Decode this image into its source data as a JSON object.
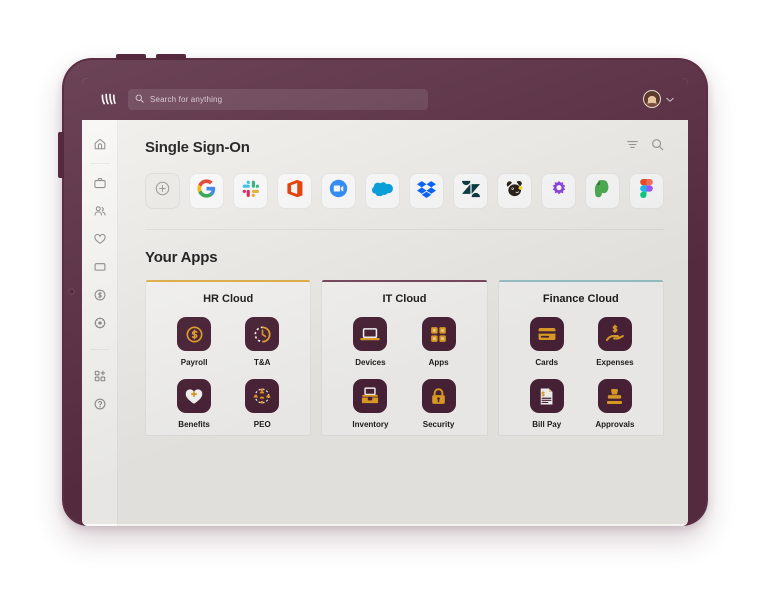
{
  "topbar": {
    "logo_icon": "rippling-logo-icon",
    "search": {
      "icon": "search-icon",
      "placeholder": "Search for anything",
      "value": ""
    },
    "avatar_name": "user-avatar",
    "chevron_icon": "chevron-down-icon"
  },
  "sidebar": {
    "items": [
      {
        "icon": "home-icon",
        "name": "home"
      },
      {
        "icon": "briefcase-icon",
        "name": "work"
      },
      {
        "icon": "people-icon",
        "name": "people"
      },
      {
        "icon": "heart-icon",
        "name": "benefits"
      },
      {
        "icon": "laptop-icon",
        "name": "devices"
      },
      {
        "icon": "dollar-icon",
        "name": "finance"
      },
      {
        "icon": "gear-icon",
        "name": "settings"
      },
      {
        "icon": "apps-grid-icon",
        "name": "apps"
      },
      {
        "icon": "help-icon",
        "name": "help"
      }
    ]
  },
  "sso": {
    "title": "Single Sign-On",
    "filter_icon": "filter-icon",
    "search_icon": "search-icon",
    "tiles": [
      {
        "name": "add-app",
        "label": "Add",
        "icon": "plus-circle-icon"
      },
      {
        "name": "google",
        "label": "Google",
        "icon": "google-icon"
      },
      {
        "name": "slack",
        "label": "Slack",
        "icon": "slack-icon"
      },
      {
        "name": "office",
        "label": "Office",
        "icon": "microsoft-office-icon"
      },
      {
        "name": "zoom",
        "label": "Zoom",
        "icon": "zoom-icon"
      },
      {
        "name": "salesforce",
        "label": "Salesforce",
        "icon": "salesforce-icon"
      },
      {
        "name": "dropbox",
        "label": "Dropbox",
        "icon": "dropbox-icon"
      },
      {
        "name": "zendesk",
        "label": "Zendesk",
        "icon": "zendesk-icon"
      },
      {
        "name": "mailchimp",
        "label": "Mailchimp",
        "icon": "mailchimp-icon"
      },
      {
        "name": "jamf",
        "label": "Jamf",
        "icon": "jamf-burst-icon"
      },
      {
        "name": "evernote",
        "label": "Evernote",
        "icon": "evernote-icon"
      },
      {
        "name": "figma",
        "label": "Figma",
        "icon": "figma-icon"
      }
    ]
  },
  "your_apps": {
    "title": "Your Apps",
    "cards": [
      {
        "title": "HR Cloud",
        "accent": "#e8b44a",
        "apps": [
          {
            "label": "Payroll",
            "icon": "dollar-circle-icon"
          },
          {
            "label": "T&A",
            "icon": "clock-icon"
          },
          {
            "label": "Benefits",
            "icon": "heart-plus-icon"
          },
          {
            "label": "PEO",
            "icon": "people-circle-icon"
          }
        ]
      },
      {
        "title": "IT Cloud",
        "accent": "#7a4a5e",
        "apps": [
          {
            "label": "Devices",
            "icon": "laptop-icon"
          },
          {
            "label": "Apps",
            "icon": "apps-grid-icon"
          },
          {
            "label": "Inventory",
            "icon": "laptop-box-icon"
          },
          {
            "label": "Security",
            "icon": "padlock-icon"
          }
        ]
      },
      {
        "title": "Finance Cloud",
        "accent": "#9ec9cc",
        "apps": [
          {
            "label": "Cards",
            "icon": "credit-card-icon"
          },
          {
            "label": "Expenses",
            "icon": "hand-dollar-icon"
          },
          {
            "label": "Bill Pay",
            "icon": "invoice-icon"
          },
          {
            "label": "Approvals",
            "icon": "stamp-icon"
          }
        ]
      }
    ]
  },
  "colors": {
    "brand_maroon": "#5b2e44",
    "app_tile_bg": "#4c2338",
    "app_icon_gold": "#e8a427",
    "screen_bg": "#f4f2ee"
  }
}
